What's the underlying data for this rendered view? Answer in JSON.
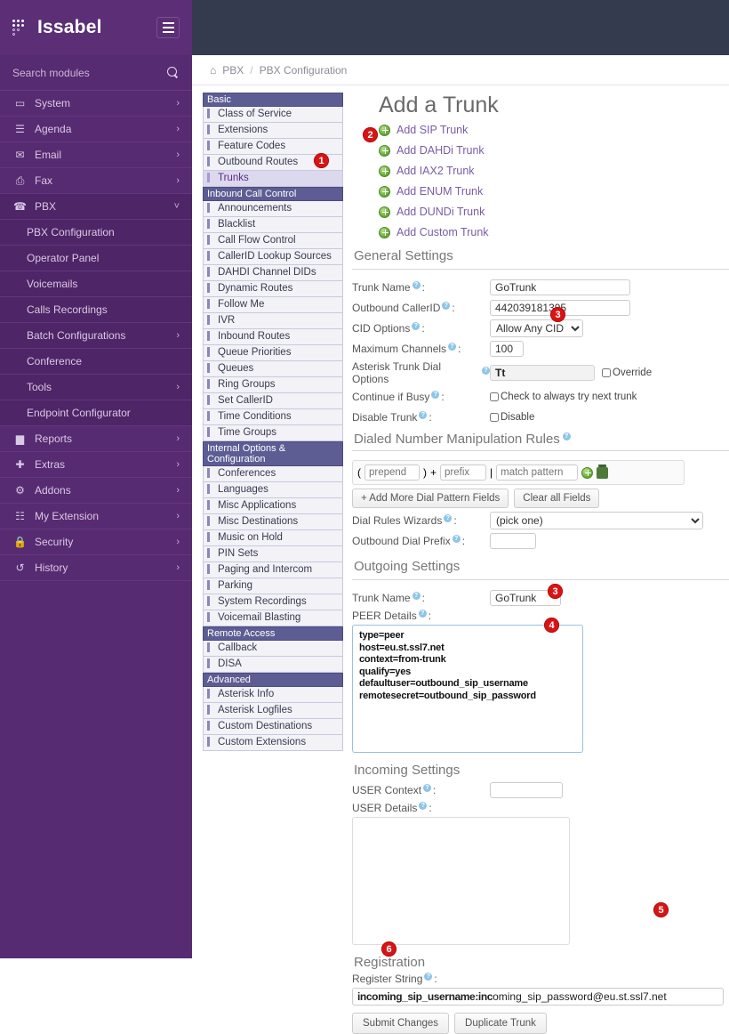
{
  "brand": {
    "name": "Issabel",
    "logo_icon": "dots-logo-icon",
    "menu_toggle_icon": "hamburger-icon"
  },
  "sidebar": {
    "search_placeholder": "Search modules",
    "search_icon": "search-icon",
    "items": [
      {
        "label": "System",
        "icon": "monitor-icon",
        "chevron": "›",
        "expandable": true
      },
      {
        "label": "Agenda",
        "icon": "book-icon",
        "chevron": "›",
        "expandable": true
      },
      {
        "label": "Email",
        "icon": "envelope-icon",
        "chevron": "›",
        "expandable": true
      },
      {
        "label": "Fax",
        "icon": "printer-icon",
        "chevron": "›",
        "expandable": true
      },
      {
        "label": "PBX",
        "icon": "phone-icon",
        "chevron": "˅",
        "expandable": true,
        "active": true
      }
    ],
    "pbx_subitems": [
      {
        "label": "PBX Configuration",
        "chevron": ""
      },
      {
        "label": "Operator Panel",
        "chevron": ""
      },
      {
        "label": "Voicemails",
        "chevron": ""
      },
      {
        "label": "Calls Recordings",
        "chevron": ""
      },
      {
        "label": "Batch Configurations",
        "chevron": "›"
      },
      {
        "label": "Conference",
        "chevron": ""
      },
      {
        "label": "Tools",
        "chevron": "›"
      },
      {
        "label": "Endpoint Configurator",
        "chevron": ""
      }
    ],
    "items_after": [
      {
        "label": "Reports",
        "icon": "chart-bar-icon",
        "chevron": "›"
      },
      {
        "label": "Extras",
        "icon": "plus-icon",
        "chevron": "›"
      },
      {
        "label": "Addons",
        "icon": "puzzle-icon",
        "chevron": "›"
      },
      {
        "label": "My Extension",
        "icon": "phone-book-icon",
        "chevron": "›"
      },
      {
        "label": "Security",
        "icon": "lock-icon",
        "chevron": "›"
      },
      {
        "label": "History",
        "icon": "clock-revert-icon",
        "chevron": "›"
      }
    ]
  },
  "breadcrumb": {
    "home_icon": "home-icon",
    "items": [
      "PBX",
      "PBX Configuration"
    ],
    "separator": "/"
  },
  "module_menu": {
    "groups": [
      {
        "title": "Basic",
        "items": [
          "Class of Service",
          "Extensions",
          "Feature Codes",
          "Outbound Routes",
          "Trunks"
        ],
        "selected": "Trunks"
      },
      {
        "title": "Inbound Call Control",
        "items": [
          "Announcements",
          "Blacklist",
          "Call Flow Control",
          "CallerID Lookup Sources",
          "DAHDI Channel DIDs",
          "Dynamic Routes",
          "Follow Me",
          "IVR",
          "Inbound Routes",
          "Queue Priorities",
          "Queues",
          "Ring Groups",
          "Set CallerID",
          "Time Conditions",
          "Time Groups"
        ]
      },
      {
        "title": "Internal Options & Configuration",
        "items": [
          "Conferences",
          "Languages",
          "Misc Applications",
          "Misc Destinations",
          "Music on Hold",
          "PIN Sets",
          "Paging and Intercom",
          "Parking",
          "System Recordings",
          "Voicemail Blasting"
        ]
      },
      {
        "title": "Remote Access",
        "items": [
          "Callback",
          "DISA"
        ]
      },
      {
        "title": "Advanced",
        "items": [
          "Asterisk Info",
          "Asterisk Logfiles",
          "Custom Destinations",
          "Custom Extensions"
        ]
      }
    ]
  },
  "main": {
    "title": "Add a Trunk",
    "trunk_links": [
      {
        "label": "Add SIP Trunk",
        "icon": "green-plus-icon"
      },
      {
        "label": "Add DAHDi Trunk",
        "icon": "green-plus-icon"
      },
      {
        "label": "Add IAX2 Trunk",
        "icon": "green-plus-icon"
      },
      {
        "label": "Add ENUM Trunk",
        "icon": "green-plus-icon"
      },
      {
        "label": "Add DUNDi Trunk",
        "icon": "green-plus-icon"
      },
      {
        "label": "Add Custom Trunk",
        "icon": "green-plus-icon"
      }
    ],
    "general_settings": {
      "heading": "General Settings",
      "trunk_name_label": "Trunk Name",
      "trunk_name_value": "GoTrunk",
      "outbound_callerid_label": "Outbound CallerID",
      "outbound_callerid_value": "442039181395",
      "cid_options_label": "CID Options",
      "cid_options_value": "Allow Any CID",
      "cid_options_choices": [
        "Allow Any CID"
      ],
      "maximum_channels_label": "Maximum Channels",
      "maximum_channels_value": "100",
      "dial_options_label": "Asterisk Trunk Dial Options",
      "dial_options_value": "Tt",
      "override_label": "Override",
      "continue_if_busy_label": "Continue if Busy",
      "continue_if_busy_checkbox_label": "Check to always try next trunk",
      "disable_trunk_label": "Disable Trunk",
      "disable_checkbox_label": "Disable"
    },
    "dial_rules": {
      "heading": "Dialed Number Manipulation Rules",
      "prepend_placeholder": "prepend",
      "prefix_placeholder": "prefix",
      "match_placeholder": "match pattern",
      "open_paren": "(",
      "close_paren": ")",
      "plus_sign": "+",
      "pipe": "|",
      "add_icon": "green-plus-icon",
      "trash_icon": "trash-icon",
      "add_more_button": "+ Add More Dial Pattern Fields",
      "clear_button": "Clear all Fields",
      "wizards_label": "Dial Rules Wizards",
      "wizards_value": "(pick one)",
      "wizards_choices": [
        "(pick one)"
      ],
      "outbound_prefix_label": "Outbound Dial Prefix",
      "outbound_prefix_value": ""
    },
    "outgoing": {
      "heading": "Outgoing Settings",
      "trunk_name_label": "Trunk Name",
      "trunk_name_value": "GoTrunk",
      "peer_details_label": "PEER Details",
      "peer_details_value": "type=peer\nhost=eu.st.ssl7.net\ncontext=from-trunk\nqualify=yes\ndefaultuser=outbound_sip_username\nremotesecret=outbound_sip_password"
    },
    "incoming": {
      "heading": "Incoming Settings",
      "user_context_label": "USER Context",
      "user_context_value": "",
      "user_details_label": "USER Details",
      "user_details_value": ""
    },
    "registration": {
      "heading": "Registration",
      "register_string_label": "Register String",
      "register_string_prefix": "incoming_sip_username:inc",
      "register_string_suffix": "oming_sip_password@eu.st.ssl7.net"
    },
    "buttons": {
      "submit": "Submit Changes",
      "duplicate": "Duplicate Trunk"
    }
  },
  "annotations": {
    "colors": {
      "badge": "#d81414",
      "sidebar": "#572b71",
      "topbar": "#343b4f",
      "link": "#7a5ca8"
    },
    "markers": [
      {
        "number": "1"
      },
      {
        "number": "2"
      },
      {
        "number": "3"
      },
      {
        "number": "4"
      },
      {
        "number": "5"
      },
      {
        "number": "6"
      },
      {
        "number": "3"
      }
    ]
  }
}
